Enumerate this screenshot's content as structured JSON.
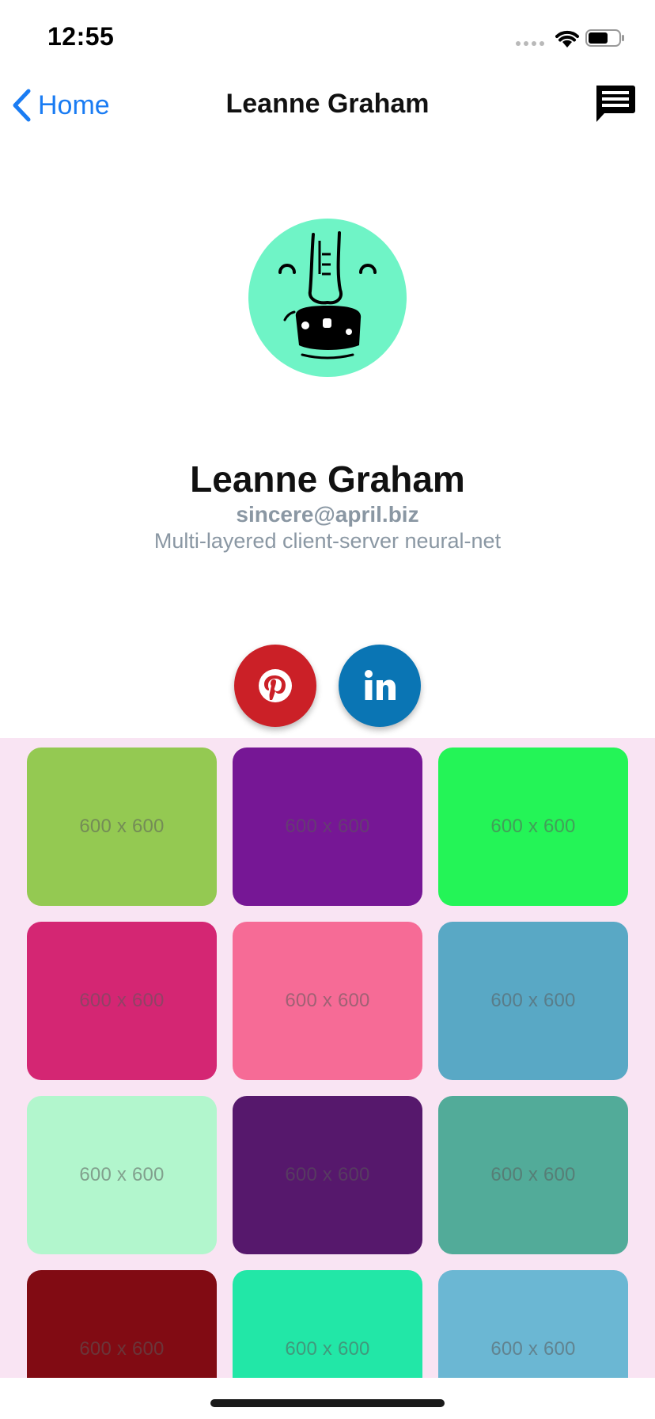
{
  "status": {
    "time": "12:55"
  },
  "nav": {
    "back_label": "Home",
    "title": "Leanne Graham"
  },
  "profile": {
    "name": "Leanne Graham",
    "email": "sincere@april.biz",
    "bio": "Multi-layered client-server neural-net"
  },
  "social": [
    {
      "icon": "pinterest-icon",
      "color": "#cb2027"
    },
    {
      "icon": "linkedin-icon",
      "color": "#0a75b4"
    }
  ],
  "gallery": {
    "background": "#f9e4f3",
    "tiles": [
      {
        "label": "600 x 600",
        "color": "#94c952"
      },
      {
        "label": "600 x 600",
        "color": "#761795"
      },
      {
        "label": "600 x 600",
        "color": "#24f457"
      },
      {
        "label": "600 x 600",
        "color": "#d42673"
      },
      {
        "label": "600 x 600",
        "color": "#f66b96"
      },
      {
        "label": "600 x 600",
        "color": "#59a8c5"
      },
      {
        "label": "600 x 600",
        "color": "#b2f6cd"
      },
      {
        "label": "600 x 600",
        "color": "#56186c"
      },
      {
        "label": "600 x 600",
        "color": "#52ab99"
      },
      {
        "label": "600 x 600",
        "color": "#810b13"
      },
      {
        "label": "600 x 600",
        "color": "#22e7a7"
      },
      {
        "label": "600 x 600",
        "color": "#6bb7d3"
      }
    ]
  }
}
